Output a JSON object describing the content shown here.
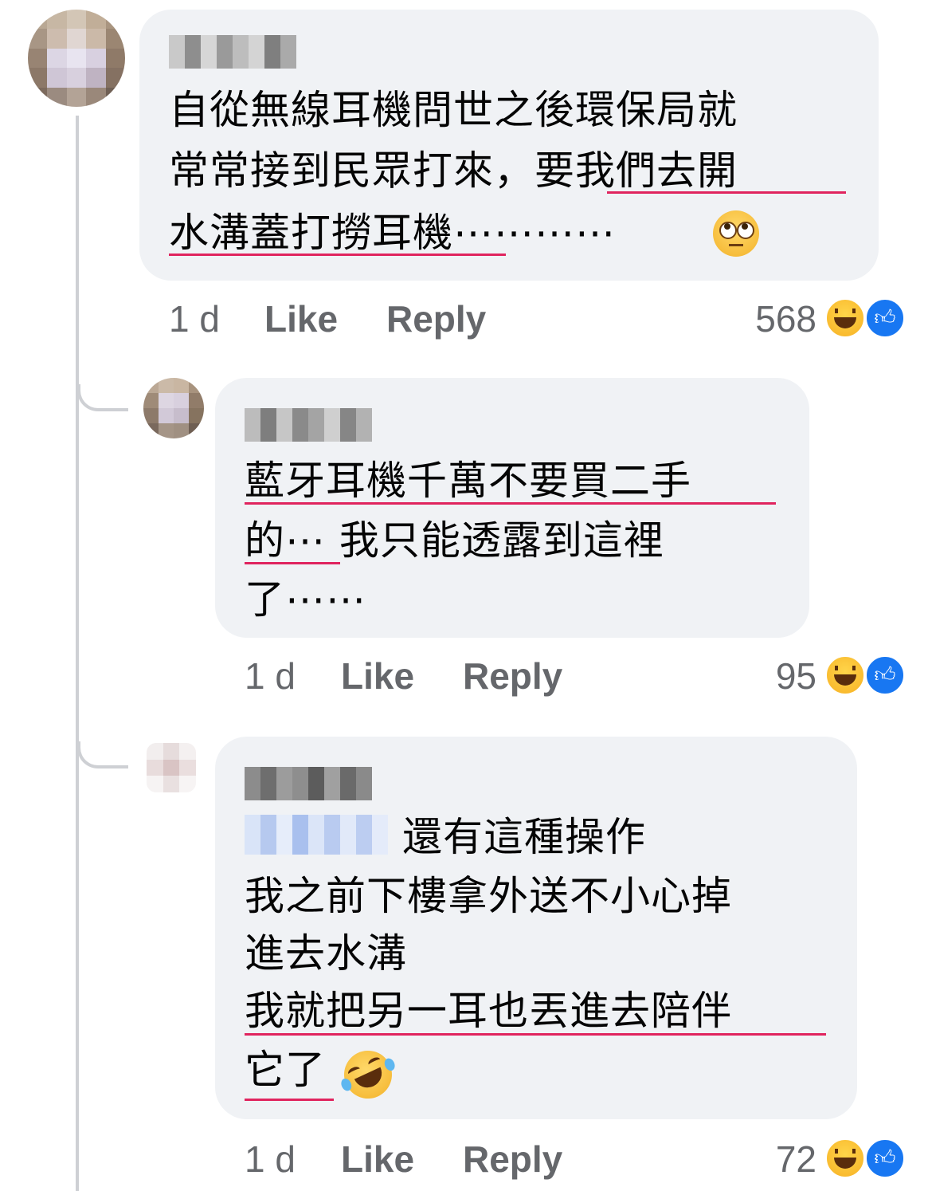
{
  "comments": [
    {
      "text_lines": [
        "自從無線耳機問世之後環保局就",
        "常常接到民眾打來，要我們去開",
        "水溝蓋打撈耳機⋯⋯⋯⋯"
      ],
      "emoji": "eye-roll-emoji",
      "time": "1 d",
      "like_label": "Like",
      "reply_label": "Reply",
      "reaction_count": "568"
    },
    {
      "text_lines": [
        "藍牙耳機千萬不要買二手",
        "的⋯ 我只能透露到這裡",
        "了⋯⋯"
      ],
      "time": "1 d",
      "like_label": "Like",
      "reply_label": "Reply",
      "reaction_count": "95"
    },
    {
      "text_lines": [
        "還有這種操作",
        "我之前下樓拿外送不小心掉",
        "進去水溝",
        "我就把另一耳也丟進去陪伴",
        "它了"
      ],
      "emoji": "rofl-emoji",
      "time": "1 d",
      "like_label": "Like",
      "reply_label": "Reply",
      "reaction_count": "72"
    }
  ],
  "reactions": [
    "haha-icon",
    "like-icon"
  ],
  "colors": {
    "bubble": "#f0f2f5",
    "meta_text": "#65676b",
    "underline": "#e0245e",
    "like_blue": "#1877f2"
  }
}
